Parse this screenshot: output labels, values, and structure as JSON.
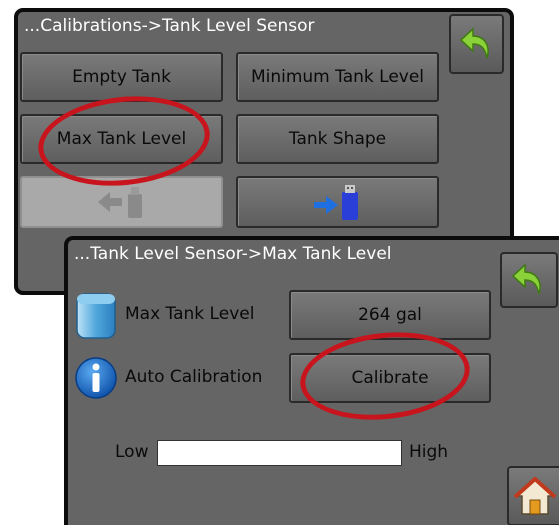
{
  "screen1": {
    "title": "...Calibrations->Tank Level Sensor",
    "buttons": {
      "empty_tank": "Empty Tank",
      "minimum_tank_level": "Minimum Tank Level",
      "max_tank_level": "Max Tank Level",
      "tank_shape": "Tank Shape"
    },
    "icons": {
      "back": "back-arrow-icon",
      "usb_import_disabled": "usb-import-icon",
      "usb_export": "usb-export-icon"
    }
  },
  "screen2": {
    "title": "...Tank Level Sensor->Max Tank Level",
    "max_tank_level_label": "Max Tank Level",
    "max_tank_level_value": "264 gal",
    "auto_calibration_label": "Auto Calibration",
    "calibrate_button": "Calibrate",
    "slider_low": "Low",
    "slider_high": "High",
    "icons": {
      "tank": "tank-icon",
      "info": "info-icon",
      "back": "back-arrow-icon",
      "home": "home-icon"
    }
  },
  "colors": {
    "screen_bg": "#656565",
    "highlight": "#c8141c",
    "back_arrow": "#8bd13a",
    "usb_blue": "#1f4fe0"
  }
}
